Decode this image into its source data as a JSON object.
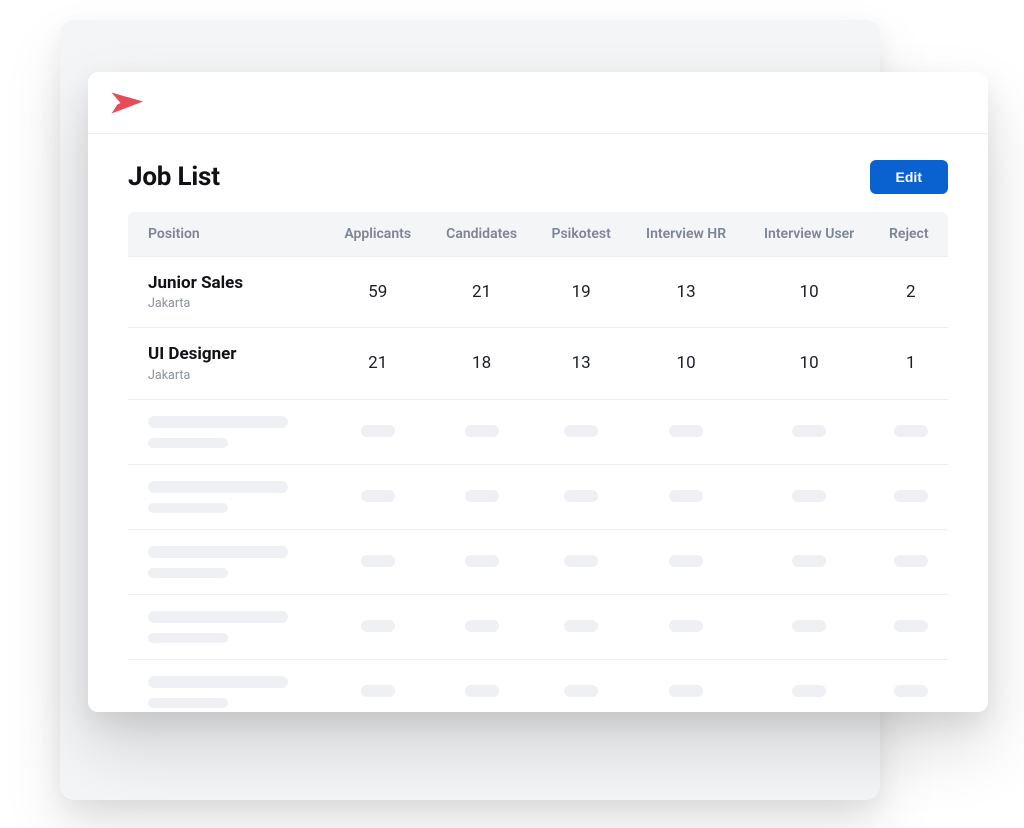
{
  "page": {
    "title": "Job List"
  },
  "actions": {
    "edit_label": "Edit"
  },
  "table": {
    "columns": {
      "position": "Position",
      "applicants": "Applicants",
      "candidates": "Candidates",
      "psikotest": "Psikotest",
      "interview_hr": "Interview HR",
      "interview_user": "Interview User",
      "reject": "Reject"
    },
    "rows": [
      {
        "position": "Junior Sales",
        "location": "Jakarta",
        "applicants": "59",
        "candidates": "21",
        "psikotest": "19",
        "interview_hr": "13",
        "interview_user": "10",
        "reject": "2"
      },
      {
        "position": "UI Designer",
        "location": "Jakarta",
        "applicants": "21",
        "candidates": "18",
        "psikotest": "13",
        "interview_hr": "10",
        "interview_user": "10",
        "reject": "1"
      }
    ],
    "skeleton_row_count": 5
  },
  "brand": {
    "logo_name": "paper-plane-logo",
    "accent": "#e74c56"
  }
}
